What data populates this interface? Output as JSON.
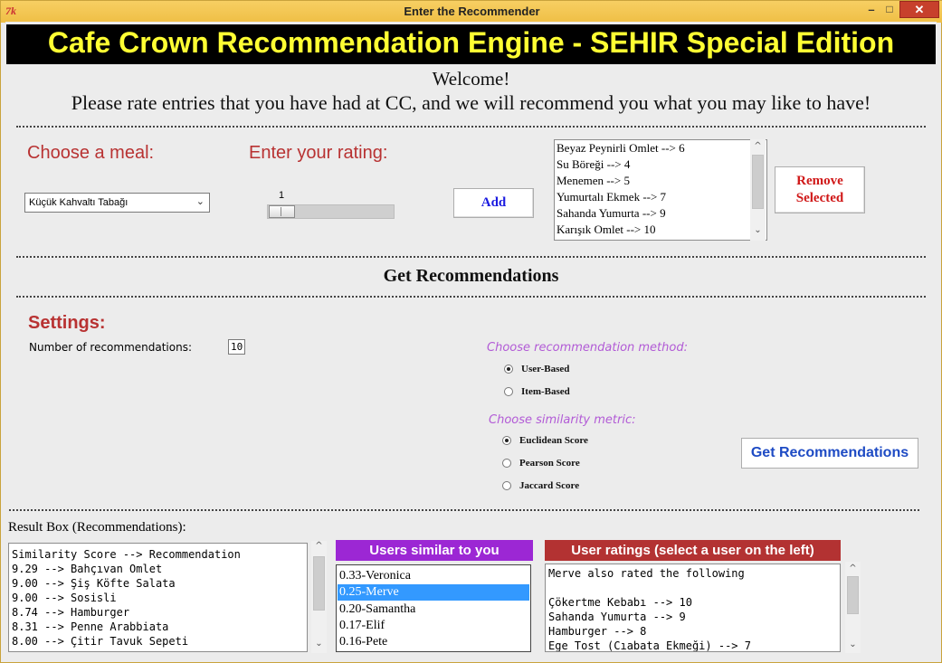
{
  "window": {
    "title": "Enter the Recommender",
    "icon_text": "7k",
    "minimize_glyph": "–",
    "maximize_glyph": "□",
    "close_glyph": "✕"
  },
  "header": {
    "title": "Cafe Crown Recommendation Engine - SEHIR Special Edition",
    "welcome": "Welcome!",
    "instructions": "Please rate entries that you have had at CC, and we will recommend you what you may like to have!"
  },
  "rate": {
    "meal_label": "Choose a meal:",
    "meal_selected": "Küçük Kahvaltı Tabağı",
    "rating_label": "Enter your rating:",
    "rating_value": "1",
    "add_label": "Add",
    "remove_label_line1": "Remove",
    "remove_label_line2": "Selected",
    "rated_items": [
      "Beyaz Peynirli Omlet --> 6",
      "Su Böreği --> 4",
      "Menemen --> 5",
      "Yumurtalı Ekmek --> 7",
      "Sahanda Yumurta --> 9",
      "Karışık Omlet --> 10"
    ]
  },
  "recommend": {
    "section_title": "Get Recommendations",
    "settings_label": "Settings:",
    "num_label": "Number of recommendations:",
    "num_value": "10",
    "method_label": "Choose recommendation method:",
    "methods": [
      "User-Based",
      "Item-Based"
    ],
    "method_selected": "User-Based",
    "metric_label": "Choose similarity metric:",
    "metrics": [
      "Euclidean Score",
      "Pearson Score",
      "Jaccard Score"
    ],
    "metric_selected": "Euclidean Score",
    "button_label": "Get Recommendations"
  },
  "results": {
    "label": "Result Box (Recommendations):",
    "lines": [
      "Similarity Score --> Recommendation",
      "9.29 --> Bahçıvan Omlet",
      "9.00 --> Şiş Köfte Salata",
      "9.00 --> Sosisli",
      "8.74 --> Hamburger",
      "8.31 --> Penne Arabbiata",
      "8.00 --> Çitir Tavuk Sepeti"
    ],
    "users_title": "Users similar to you",
    "users": [
      "0.33-Veronica",
      "0.25-Merve",
      "0.20-Samantha",
      "0.17-Elif",
      "0.16-Pete"
    ],
    "selected_user": "0.25-Merve",
    "ratings_title": "User ratings (select a user on the left)",
    "user_rating_lines": [
      "Merve also rated the following",
      "",
      "Çökertme Kebabı --> 10",
      "Sahanda Yumurta --> 9",
      "Hamburger --> 8",
      "Ege Tost (Cıabata Ekmeği) --> 7"
    ]
  },
  "colors": {
    "banner_bg": "#000000",
    "banner_text": "#ffff33",
    "label_red": "#b83232",
    "purple": "#9c27d4",
    "selection_blue": "#3399ff",
    "link_blue": "#1a1ae0"
  }
}
